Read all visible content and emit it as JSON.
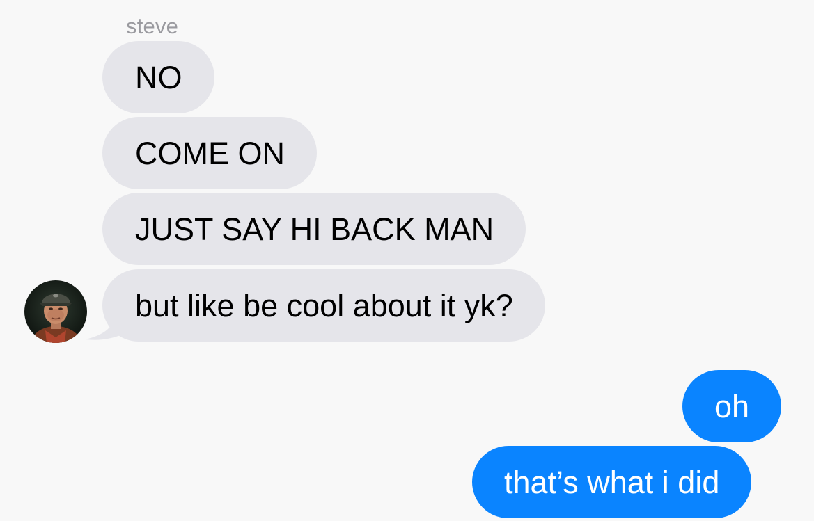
{
  "conversation": {
    "sender_name": "steve",
    "incoming": [
      {
        "text": "NO"
      },
      {
        "text": "COME ON"
      },
      {
        "text": "JUST SAY HI BACK MAN"
      },
      {
        "text": "but like be cool about it yk?"
      }
    ],
    "outgoing": [
      {
        "text": "oh"
      },
      {
        "text": "that’s what i did"
      }
    ]
  },
  "colors": {
    "background": "#f8f8f8",
    "incoming_bubble": "#e5e5ea",
    "outgoing_bubble": "#0a84ff",
    "sender_name": "#9a9a9f"
  }
}
